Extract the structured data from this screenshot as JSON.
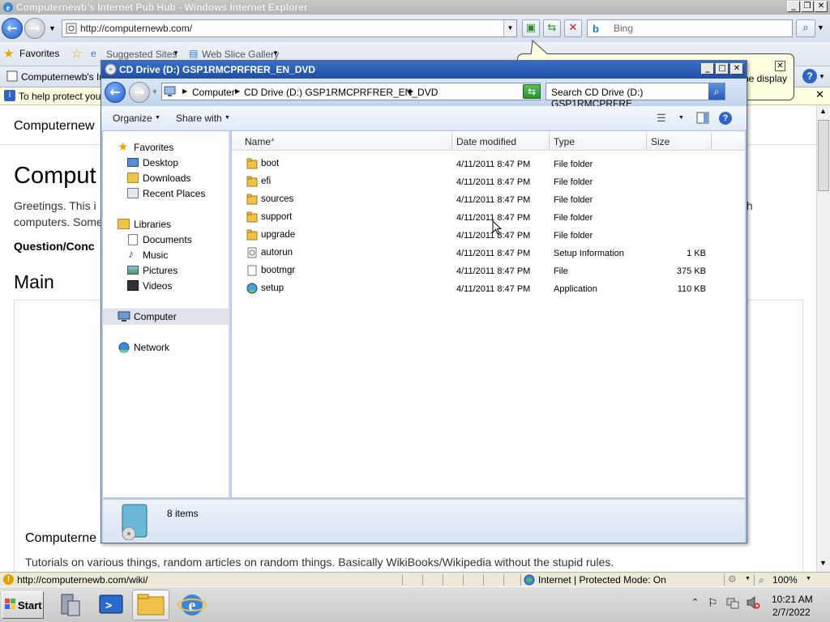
{
  "ie": {
    "title": "Computernewb's Internet Pub Hub - Windows Internet Explorer",
    "address": "http://computernewb.com/",
    "search_placeholder": "Bing",
    "favorites_label": "Favorites",
    "suggested_sites": "Suggested Sites",
    "web_slice_gallery": "Web Slice Gallery",
    "tab_title": "Computernewb's Int",
    "infobar_text": "To help protect your",
    "balloon_text": "ne display",
    "content": {
      "heading_small": "Computernew",
      "heading_big": "Comput",
      "greeting": "Greetings. This i",
      "greeting_right": "th",
      "line2": "computers. Some",
      "question": "Question/Conc",
      "main": "Main",
      "section2": "Computerne",
      "tutorials": "Tutorials on various things, random articles on random things. Basically WikiBooks/Wikipedia without the stupid rules."
    },
    "status_url": "http://computernewb.com/wiki/",
    "zone": "Internet | Protected Mode: On",
    "zoom": "100%"
  },
  "explorer": {
    "title": "CD Drive (D:) GSP1RMCPRFRER_EN_DVD",
    "breadcrumb": [
      "Computer",
      "CD Drive (D:) GSP1RMCPRFRER_EN_DVD"
    ],
    "search_placeholder": "Search CD Drive (D:) GSP1RMCPRFRE...",
    "toolbar": {
      "organize": "Organize",
      "share_with": "Share with"
    },
    "nav": {
      "favorites": "Favorites",
      "desktop": "Desktop",
      "downloads": "Downloads",
      "recent": "Recent Places",
      "libraries": "Libraries",
      "documents": "Documents",
      "music": "Music",
      "pictures": "Pictures",
      "videos": "Videos",
      "computer": "Computer",
      "network": "Network"
    },
    "columns": {
      "name": "Name",
      "date": "Date modified",
      "type": "Type",
      "size": "Size"
    },
    "files": [
      {
        "name": "boot",
        "date": "4/11/2011 8:47 PM",
        "type": "File folder",
        "size": "",
        "icon": "folder-icon"
      },
      {
        "name": "efi",
        "date": "4/11/2011 8:47 PM",
        "type": "File folder",
        "size": "",
        "icon": "folder-icon"
      },
      {
        "name": "sources",
        "date": "4/11/2011 8:47 PM",
        "type": "File folder",
        "size": "",
        "icon": "folder-icon"
      },
      {
        "name": "support",
        "date": "4/11/2011 8:47 PM",
        "type": "File folder",
        "size": "",
        "icon": "folder-icon"
      },
      {
        "name": "upgrade",
        "date": "4/11/2011 8:47 PM",
        "type": "File folder",
        "size": "",
        "icon": "folder-icon"
      },
      {
        "name": "autorun",
        "date": "4/11/2011 8:47 PM",
        "type": "Setup Information",
        "size": "1 KB",
        "icon": "setup-info-icon"
      },
      {
        "name": "bootmgr",
        "date": "4/11/2011 8:47 PM",
        "type": "File",
        "size": "375 KB",
        "icon": "file-icon"
      },
      {
        "name": "setup",
        "date": "4/11/2011 8:47 PM",
        "type": "Application",
        "size": "110 KB",
        "icon": "application-icon"
      }
    ],
    "item_count": "8 items"
  },
  "taskbar": {
    "start": "Start",
    "time": "10:21 AM",
    "date": "2/7/2022"
  },
  "colors": {
    "folder": "#f0c24a",
    "title_blue": "#2a5cb4",
    "infobar": "#ffffe1"
  }
}
